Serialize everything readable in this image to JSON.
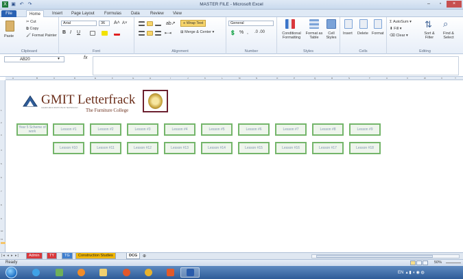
{
  "window": {
    "title": "MASTER FILE - Microsoft Excel"
  },
  "ribbon_tabs": [
    "File",
    "Home",
    "Insert",
    "Page Layout",
    "Formulas",
    "Data",
    "Review",
    "View"
  ],
  "clipboard": {
    "paste": "Paste",
    "cut": "Cut",
    "copy": "Copy",
    "format_painter": "Format Painter",
    "label": "Clipboard"
  },
  "font": {
    "name": "Arial",
    "size": "36",
    "bold": "B",
    "italic": "I",
    "underline": "U",
    "label": "Font"
  },
  "alignment": {
    "wrap_text": "Wrap Text",
    "merge_center": "Merge & Center",
    "label": "Alignment"
  },
  "number": {
    "format": "General",
    "percent": "%",
    "comma": ",",
    "label": "Number"
  },
  "styles": {
    "conditional": "Conditional Formatting",
    "format_table": "Format as Table",
    "cell_styles": "Cell Styles",
    "label": "Styles"
  },
  "cells": {
    "insert": "Insert",
    "delete": "Delete",
    "format": "Format",
    "label": "Cells"
  },
  "editing": {
    "autosum": "AutoSum",
    "fill": "Fill",
    "clear": "Clear",
    "sort_filter": "Sort & Filter",
    "find_select": "Find & Select",
    "label": "Editing"
  },
  "formula_bar": {
    "name_box": "AB20",
    "fx": "fx",
    "content": ""
  },
  "logo": {
    "brand": "GMIT Letterfrack",
    "tagline": "GALWAY-MAYO INSTITUTE OF TECHNOLOGY",
    "college": "The Furniture College"
  },
  "grid": {
    "row1": [
      "Year 5 Scheme of work",
      "Lesson #1",
      "Lesson #2",
      "Lesson #3",
      "Lesson #4",
      "Lesson #5",
      "Lesson #6",
      "Lesson #7",
      "Lesson #8",
      "Lesson #9"
    ],
    "row2": [
      "Lesson #10",
      "Lesson #11",
      "Lesson #12",
      "Lesson #13",
      "Lesson #14",
      "Lesson #15",
      "Lesson #16",
      "Lesson #17",
      "Lesson #18"
    ]
  },
  "sheet_tabs": [
    {
      "name": "Admin",
      "color": "#d9373b"
    },
    {
      "name": "TY",
      "color": "#d9373b"
    },
    {
      "name": "TG",
      "color": "#3f7fcf"
    },
    {
      "name": "Construction Studies",
      "color": "#f2b705"
    },
    {
      "name": "DCG",
      "color": "#ffffff"
    }
  ],
  "status": {
    "ready": "Ready",
    "zoom": "50%"
  },
  "tray": {
    "lang": "EN"
  }
}
